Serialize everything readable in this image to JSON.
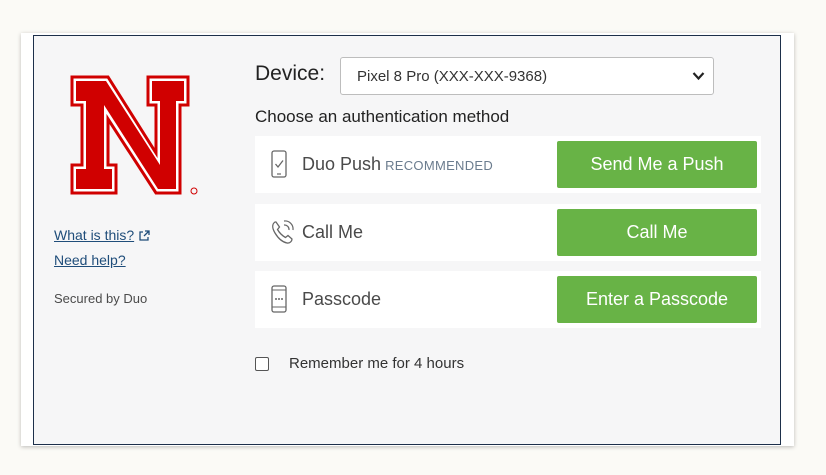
{
  "sidebar": {
    "what_is_this": "What is this?",
    "need_help": "Need help?",
    "secured_by": "Secured by Duo"
  },
  "device": {
    "label": "Device:",
    "selected": "Pixel 8 Pro (XXX-XXX-9368)"
  },
  "choose_text": "Choose an authentication method",
  "methods": [
    {
      "icon": "phone-check-icon",
      "label": "Duo Push",
      "tag": "RECOMMENDED",
      "button": "Send Me a Push"
    },
    {
      "icon": "phone-call-icon",
      "label": "Call Me",
      "tag": "",
      "button": "Call Me"
    },
    {
      "icon": "phone-passcode-icon",
      "label": "Passcode",
      "tag": "",
      "button": "Enter a Passcode"
    }
  ],
  "remember": {
    "label": "Remember me for 4 hours",
    "checked": false
  },
  "colors": {
    "accent_green": "#68b346",
    "nebraska_red": "#d00000",
    "link_blue": "#1f4d7a",
    "frame_border": "#1d2f4a"
  }
}
